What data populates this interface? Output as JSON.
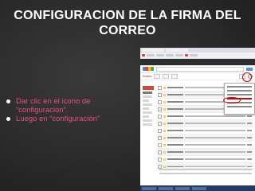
{
  "slide": {
    "title": "CONFIGURACION DE LA FIRMA DEL CORREO",
    "bullets": [
      "Dar clic en el icono de “configuracion”.",
      "Luego en “configuración”"
    ]
  },
  "screenshot": {
    "mail_label": "Correo",
    "settings_icon": "gear-icon"
  },
  "colors": {
    "background": "#2a2a2a",
    "title": "#ffffff",
    "bullet_text": "#e84d88",
    "highlight": "#d40000"
  }
}
